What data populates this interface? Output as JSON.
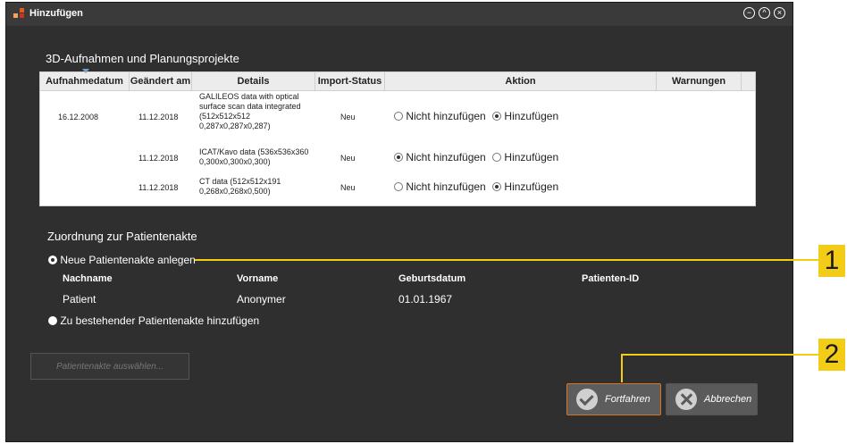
{
  "window": {
    "title": "Hinzufügen",
    "buttons": [
      "minimize",
      "maximize",
      "close"
    ]
  },
  "recordings": {
    "title": "3D-Aufnahmen und Planungsprojekte",
    "columns": [
      "Aufnahmedatum",
      "Geändert am",
      "Details",
      "Import-Status",
      "Aktion",
      "Warnungen"
    ],
    "rows": [
      {
        "recorded": "16.12.2008",
        "changed": "11.12.2018",
        "details": "GALILEOS data with optical surface scan data integrated (512x512x512 0,287x0,287x0,287)",
        "status": "Neu",
        "option_a": "Nicht hinzufügen",
        "option_b": "Hinzufügen",
        "selected": "b"
      },
      {
        "recorded": "",
        "changed": "11.12.2018",
        "details": "ICAT/Kavo data (536x536x360 0,300x0,300x0,300)",
        "status": "Neu",
        "option_a": "Nicht hinzufügen",
        "option_b": "Hinzufügen",
        "selected": "a"
      },
      {
        "recorded": "",
        "changed": "11.12.2018",
        "details": "CT data (512x512x191 0,268x0,268x0,500)",
        "status": "Neu",
        "option_a": "Nicht hinzufügen",
        "option_b": "Hinzufügen",
        "selected": "b"
      }
    ]
  },
  "assignment": {
    "title": "Zuordnung zur Patientenakte",
    "new_record_label": "Neue Patientenakte anlegen",
    "existing_record_label": "Zu bestehender Patientenakte hinzufügen",
    "selected": "new",
    "columns": [
      "Nachname",
      "Vorname",
      "Geburtsdatum",
      "Patienten-ID"
    ],
    "values": [
      "Patient",
      "Anonymer",
      "01.01.1967",
      ""
    ],
    "select_record_button": "Patientenakte auswählen..."
  },
  "actions": {
    "continue_label": "Fortfahren",
    "cancel_label": "Abbrechen"
  },
  "callouts": [
    "1",
    "2"
  ],
  "colors": {
    "window_bg": "#2f2f2f",
    "accent": "#d9731c",
    "callout": "#f2cc17"
  }
}
